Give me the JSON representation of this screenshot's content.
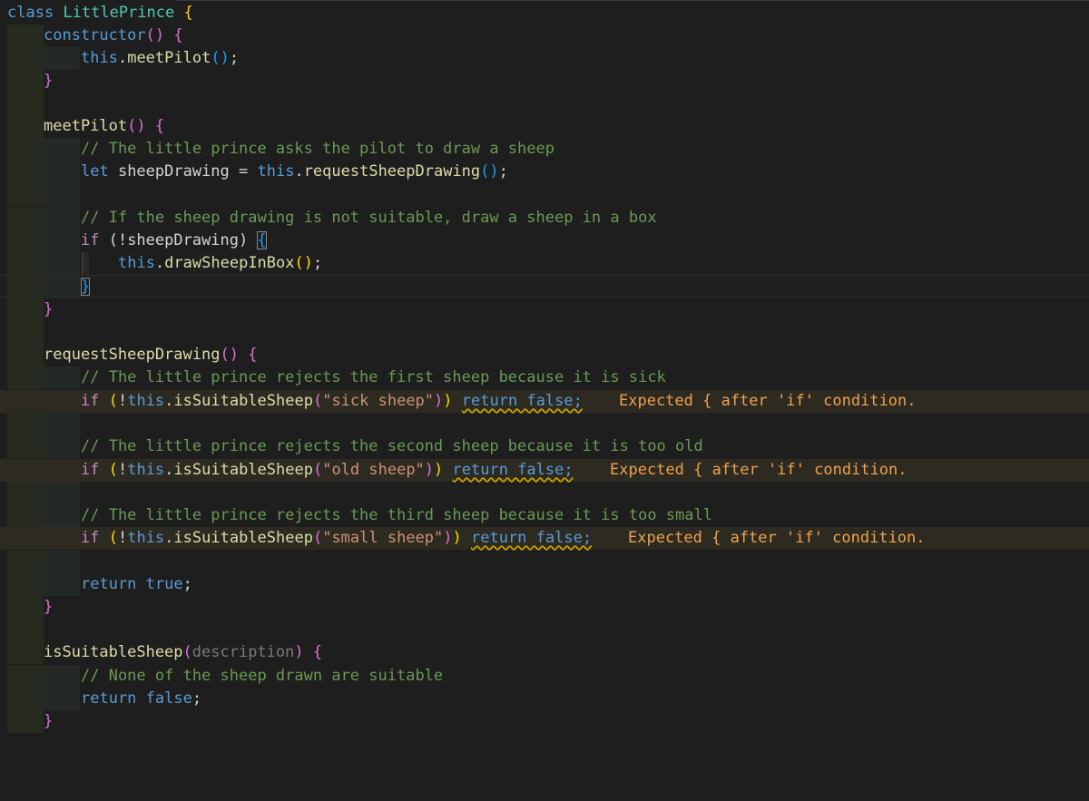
{
  "editor": {
    "lines": {
      "l1": {
        "a": "class",
        "b": "LittlePrince",
        "c": "{"
      },
      "l2": {
        "a": "constructor",
        "b": "()",
        "c": "{"
      },
      "l3": {
        "a": "this",
        "b": ".",
        "c": "meetPilot",
        "d": "()",
        "e": ";"
      },
      "l4": {
        "a": "}"
      },
      "l6": {
        "a": "meetPilot",
        "b": "()",
        "c": "{"
      },
      "l7": {
        "a": "// The little prince asks the pilot to draw a sheep"
      },
      "l8": {
        "a": "let",
        "b": " sheepDrawing = ",
        "c": "this",
        "d": ".",
        "e": "requestSheepDrawing",
        "f": "()",
        "g": ";"
      },
      "l10": {
        "a": "// If the sheep drawing is not suitable, draw a sheep in a box"
      },
      "l11": {
        "a": "if",
        "b": " (!sheepDrawing) ",
        "c": "{"
      },
      "l12": {
        "a": "this",
        "b": ".",
        "c": "drawSheepInBox",
        "d": "()",
        "e": ";"
      },
      "l13": {
        "a": "}"
      },
      "l14": {
        "a": "}"
      },
      "l16": {
        "a": "requestSheepDrawing",
        "b": "()",
        "c": "{"
      },
      "l17": {
        "a": "// The little prince rejects the first sheep because it is sick"
      },
      "l18": {
        "a": "if",
        "b": " (",
        "c": "!",
        "d": "this",
        "e": ".",
        "f": "isSuitableSheep",
        "g": "(",
        "h": "\"sick sheep\"",
        "i": ")",
        "j": ")",
        "k": "return false;",
        "lens": "Expected { after 'if' condition."
      },
      "l20": {
        "a": "// The little prince rejects the second sheep because it is too old"
      },
      "l21": {
        "a": "if",
        "b": " (",
        "c": "!",
        "d": "this",
        "e": ".",
        "f": "isSuitableSheep",
        "g": "(",
        "h": "\"old sheep\"",
        "i": ")",
        "j": ")",
        "k": "return false;",
        "lens": "Expected { after 'if' condition."
      },
      "l23": {
        "a": "// The little prince rejects the third sheep because it is too small"
      },
      "l24": {
        "a": "if",
        "b": " (",
        "c": "!",
        "d": "this",
        "e": ".",
        "f": "isSuitableSheep",
        "g": "(",
        "h": "\"small sheep\"",
        "i": ")",
        "j": ")",
        "k": "return false;",
        "lens": "Expected { after 'if' condition."
      },
      "l26": {
        "a": "return",
        "b": " ",
        "c": "true",
        "d": ";"
      },
      "l27": {
        "a": "}"
      },
      "l29": {
        "a": "isSuitableSheep",
        "b": "(",
        "c": "description",
        "d": ")",
        "e": "{"
      },
      "l30": {
        "a": "// None of the sheep drawn are suitable"
      },
      "l31": {
        "a": "return",
        "b": " ",
        "c": "false",
        "d": ";"
      },
      "l32": {
        "a": "}"
      }
    }
  },
  "colors": {
    "background": "#1e1e1e",
    "keyword": "#569cd6",
    "control": "#c586c0",
    "function": "#dcdcaa",
    "class": "#4ec9b0",
    "string": "#ce9178",
    "comment": "#6a9955",
    "warning_lens": "#f0a24c"
  }
}
